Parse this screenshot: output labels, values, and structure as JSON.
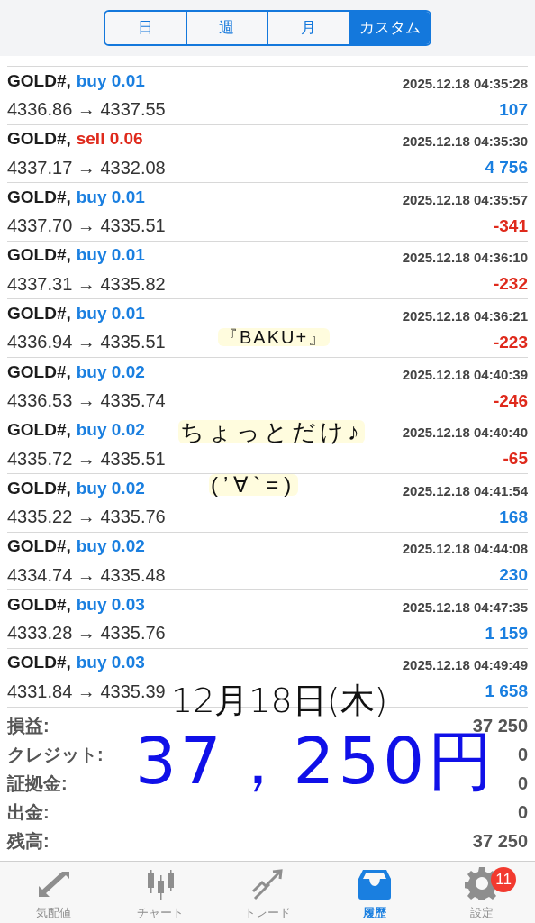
{
  "period_tabs": [
    {
      "label": "日",
      "selected": false
    },
    {
      "label": "週",
      "selected": false
    },
    {
      "label": "月",
      "selected": false
    },
    {
      "label": "カスタム",
      "selected": true
    }
  ],
  "trades": [
    {
      "symbol": "GOLD#,",
      "sell": false,
      "volume": "buy 0.01",
      "time": "2025.12.18 04:35:28",
      "prices": "4336.86 → 4337.55",
      "profit": "107",
      "loss": false
    },
    {
      "symbol": "GOLD#,",
      "sell": true,
      "volume": "sell 0.06",
      "time": "2025.12.18 04:35:30",
      "prices": "4337.17 → 4332.08",
      "profit": "4 756",
      "loss": false
    },
    {
      "symbol": "GOLD#,",
      "sell": false,
      "volume": "buy 0.01",
      "time": "2025.12.18 04:35:57",
      "prices": "4337.70 → 4335.51",
      "profit": "-341",
      "loss": true
    },
    {
      "symbol": "GOLD#,",
      "sell": false,
      "volume": "buy 0.01",
      "time": "2025.12.18 04:36:10",
      "prices": "4337.31 → 4335.82",
      "profit": "-232",
      "loss": true
    },
    {
      "symbol": "GOLD#,",
      "sell": false,
      "volume": "buy 0.01",
      "time": "2025.12.18 04:36:21",
      "prices": "4336.94 → 4335.51",
      "profit": "-223",
      "loss": true
    },
    {
      "symbol": "GOLD#,",
      "sell": false,
      "volume": "buy 0.02",
      "time": "2025.12.18 04:40:39",
      "prices": "4336.53 → 4335.74",
      "profit": "-246",
      "loss": true
    },
    {
      "symbol": "GOLD#,",
      "sell": false,
      "volume": "buy 0.02",
      "time": "2025.12.18 04:40:40",
      "prices": "4335.72 → 4335.51",
      "profit": "-65",
      "loss": true
    },
    {
      "symbol": "GOLD#,",
      "sell": false,
      "volume": "buy 0.02",
      "time": "2025.12.18 04:41:54",
      "prices": "4335.22 → 4335.76",
      "profit": "168",
      "loss": false
    },
    {
      "symbol": "GOLD#,",
      "sell": false,
      "volume": "buy 0.02",
      "time": "2025.12.18 04:44:08",
      "prices": "4334.74 → 4335.48",
      "profit": "230",
      "loss": false
    },
    {
      "symbol": "GOLD#,",
      "sell": false,
      "volume": "buy 0.03",
      "time": "2025.12.18 04:47:35",
      "prices": "4333.28 → 4335.76",
      "profit": "1 159",
      "loss": false
    },
    {
      "symbol": "GOLD#,",
      "sell": false,
      "volume": "buy 0.03",
      "time": "2025.12.18 04:49:49",
      "prices": "4331.84 → 4335.39",
      "profit": "1 658",
      "loss": false
    }
  ],
  "summary": [
    {
      "label": "損益:",
      "value": "37 250"
    },
    {
      "label": "クレジット:",
      "value": "0"
    },
    {
      "label": "証拠金:",
      "value": "0"
    },
    {
      "label": "出金:",
      "value": "0"
    },
    {
      "label": "残高:",
      "value": "37 250"
    }
  ],
  "annotations": [
    {
      "kind": "tag",
      "text": "『BAKU+』"
    },
    {
      "kind": "note",
      "text": "ちょっとだけ♪"
    },
    {
      "kind": "face",
      "text": "(’∀`=)"
    },
    {
      "kind": "date",
      "text": "12月18日(木)"
    },
    {
      "kind": "amount",
      "text": "37，250円"
    }
  ],
  "nav": [
    {
      "kind": "quotes",
      "label": "気配値",
      "selected": false
    },
    {
      "kind": "chart",
      "label": "チャート",
      "selected": false
    },
    {
      "kind": "trade",
      "label": "トレード",
      "selected": false
    },
    {
      "kind": "history",
      "label": "履歴",
      "selected": true
    },
    {
      "kind": "settings",
      "label": "設定",
      "selected": false,
      "badge": "11"
    }
  ]
}
